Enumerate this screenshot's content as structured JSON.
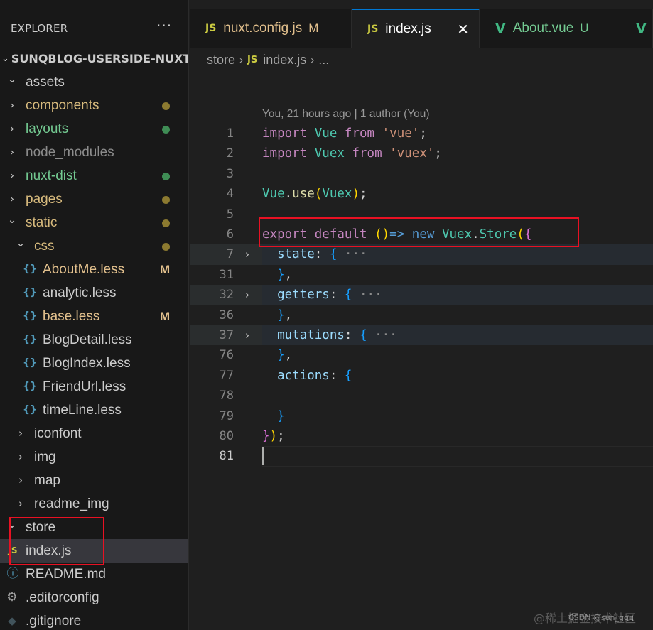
{
  "explorer": {
    "title": "EXPLORER",
    "more_label": "···",
    "root_label": "SUNQBLOG-USERSIDE-NUXT",
    "items": [
      {
        "label": "assets",
        "kind": "folder",
        "open": true,
        "color": "#cccccc"
      },
      {
        "label": "components",
        "kind": "folder",
        "open": false,
        "color": "#d7ba7d",
        "dot": "#8c7a30"
      },
      {
        "label": "layouts",
        "kind": "folder",
        "open": false,
        "color": "#73c991",
        "dot": "#3f8d55"
      },
      {
        "label": "node_modules",
        "kind": "folder",
        "open": false,
        "color": "#8c8c8c"
      },
      {
        "label": "nuxt-dist",
        "kind": "folder",
        "open": false,
        "color": "#73c991",
        "dot": "#3f8d55"
      },
      {
        "label": "pages",
        "kind": "folder",
        "open": false,
        "color": "#d7ba7d",
        "dot": "#8c7a30"
      },
      {
        "label": "static",
        "kind": "folder",
        "open": true,
        "color": "#d7ba7d",
        "dot": "#8c7a30"
      },
      {
        "label": "css",
        "kind": "folder",
        "open": true,
        "color": "#d7ba7d",
        "dot": "#8c7a30"
      },
      {
        "label": "AboutMe.less",
        "kind": "less",
        "color": "#e2c08d",
        "status": "M"
      },
      {
        "label": "analytic.less",
        "kind": "less",
        "color": "#cccccc"
      },
      {
        "label": "base.less",
        "kind": "less",
        "color": "#e2c08d",
        "status": "M"
      },
      {
        "label": "BlogDetail.less",
        "kind": "less",
        "color": "#cccccc"
      },
      {
        "label": "BlogIndex.less",
        "kind": "less",
        "color": "#cccccc"
      },
      {
        "label": "FriendUrl.less",
        "kind": "less",
        "color": "#cccccc"
      },
      {
        "label": "timeLine.less",
        "kind": "less",
        "color": "#cccccc"
      },
      {
        "label": "iconfont",
        "kind": "folder",
        "open": false,
        "color": "#cccccc"
      },
      {
        "label": "img",
        "kind": "folder",
        "open": false,
        "color": "#cccccc"
      },
      {
        "label": "map",
        "kind": "folder",
        "open": false,
        "color": "#cccccc"
      },
      {
        "label": "readme_img",
        "kind": "folder",
        "open": false,
        "color": "#cccccc"
      },
      {
        "label": "store",
        "kind": "folder",
        "open": true,
        "color": "#cccccc"
      },
      {
        "label": "index.js",
        "kind": "js",
        "color": "#cccccc",
        "selected": true
      },
      {
        "label": "README.md",
        "kind": "info",
        "color": "#cccccc"
      },
      {
        "label": ".editorconfig",
        "kind": "gear",
        "color": "#cccccc"
      },
      {
        "label": ".gitignore",
        "kind": "git",
        "color": "#cccccc"
      }
    ]
  },
  "tabs": [
    {
      "icon": "JS",
      "icon_color": "#cbcb41",
      "label": "nuxt.config.js",
      "label_color": "#e2c08d",
      "status": "M",
      "status_color": "#e2c08d",
      "active": false
    },
    {
      "icon": "JS",
      "icon_color": "#cbcb41",
      "label": "index.js",
      "label_color": "#ffffff",
      "status": "",
      "active": true,
      "close": "✕"
    },
    {
      "icon": "V",
      "icon_color": "#41b883",
      "label": "About.vue",
      "label_color": "#73c991",
      "status": "U",
      "status_color": "#73c991",
      "active": false
    },
    {
      "icon": "V",
      "icon_color": "#41b883",
      "label": "",
      "active": false
    }
  ],
  "breadcrumb": {
    "folder": "store",
    "file_icon": "JS",
    "file": "index.js",
    "tail": "..."
  },
  "codelens": "You, 21 hours ago | 1 author (You)",
  "code_lines": [
    {
      "num": "1",
      "fold": "",
      "tokens": [
        [
          "import",
          "kw"
        ],
        [
          " ",
          "pun"
        ],
        [
          "Vue",
          "cls"
        ],
        [
          " ",
          "pun"
        ],
        [
          "from",
          "kw"
        ],
        [
          " ",
          "pun"
        ],
        [
          "'vue'",
          "str"
        ],
        [
          ";",
          "pun"
        ]
      ]
    },
    {
      "num": "2",
      "fold": "",
      "tokens": [
        [
          "import",
          "kw"
        ],
        [
          " ",
          "pun"
        ],
        [
          "Vuex",
          "cls"
        ],
        [
          " ",
          "pun"
        ],
        [
          "from",
          "kw"
        ],
        [
          " ",
          "pun"
        ],
        [
          "'vuex'",
          "str"
        ],
        [
          ";",
          "pun"
        ]
      ]
    },
    {
      "num": "3",
      "fold": "",
      "tokens": []
    },
    {
      "num": "4",
      "fold": "",
      "tokens": [
        [
          "Vue",
          "cls"
        ],
        [
          ".",
          "pun"
        ],
        [
          "use",
          "fn"
        ],
        [
          "(",
          "brk1"
        ],
        [
          "Vuex",
          "cls"
        ],
        [
          ")",
          "brk1"
        ],
        [
          ";",
          "pun"
        ]
      ]
    },
    {
      "num": "5",
      "fold": "",
      "tokens": []
    },
    {
      "num": "6",
      "fold": "",
      "tokens": [
        [
          "export",
          "kw"
        ],
        [
          " ",
          "pun"
        ],
        [
          "default",
          "kw"
        ],
        [
          " ",
          "pun"
        ],
        [
          "()",
          "brk1"
        ],
        [
          "=>",
          "def"
        ],
        [
          " ",
          "pun"
        ],
        [
          "new",
          "def"
        ],
        [
          " ",
          "pun"
        ],
        [
          "Vuex",
          "cls"
        ],
        [
          ".",
          "pun"
        ],
        [
          "Store",
          "cls"
        ],
        [
          "(",
          "brk1"
        ],
        [
          "{",
          "brk2"
        ]
      ]
    },
    {
      "num": "7",
      "fold": "›",
      "folded": true,
      "tokens": [
        [
          "  ",
          "pun"
        ],
        [
          "state",
          "var"
        ],
        [
          ": ",
          "pun"
        ],
        [
          "{",
          "brk3"
        ],
        [
          " ···",
          "ell"
        ]
      ]
    },
    {
      "num": "31",
      "fold": "",
      "tokens": [
        [
          "  ",
          "pun"
        ],
        [
          "}",
          "brk3"
        ],
        [
          ",",
          "pun"
        ]
      ]
    },
    {
      "num": "32",
      "fold": "›",
      "folded": true,
      "tokens": [
        [
          "  ",
          "pun"
        ],
        [
          "getters",
          "var"
        ],
        [
          ": ",
          "pun"
        ],
        [
          "{",
          "brk3"
        ],
        [
          " ···",
          "ell"
        ]
      ]
    },
    {
      "num": "36",
      "fold": "",
      "tokens": [
        [
          "  ",
          "pun"
        ],
        [
          "}",
          "brk3"
        ],
        [
          ",",
          "pun"
        ]
      ]
    },
    {
      "num": "37",
      "fold": "›",
      "folded": true,
      "tokens": [
        [
          "  ",
          "pun"
        ],
        [
          "mutations",
          "var"
        ],
        [
          ": ",
          "pun"
        ],
        [
          "{",
          "brk3"
        ],
        [
          " ···",
          "ell"
        ]
      ]
    },
    {
      "num": "76",
      "fold": "",
      "tokens": [
        [
          "  ",
          "pun"
        ],
        [
          "}",
          "brk3"
        ],
        [
          ",",
          "pun"
        ]
      ]
    },
    {
      "num": "77",
      "fold": "",
      "tokens": [
        [
          "  ",
          "pun"
        ],
        [
          "actions",
          "var"
        ],
        [
          ": ",
          "pun"
        ],
        [
          "{",
          "brk3"
        ]
      ]
    },
    {
      "num": "78",
      "fold": "",
      "tokens": []
    },
    {
      "num": "79",
      "fold": "",
      "tokens": [
        [
          "  ",
          "pun"
        ],
        [
          "}",
          "brk3"
        ]
      ]
    },
    {
      "num": "80",
      "fold": "",
      "tokens": [
        [
          "}",
          "brk2"
        ],
        [
          ")",
          "brk1"
        ],
        [
          ";",
          "pun"
        ]
      ]
    },
    {
      "num": "81",
      "fold": "",
      "current": true,
      "tokens": []
    }
  ],
  "watermark": "@稀土掘金技术社区",
  "watermark2": "CSDN @sun_qqq",
  "colors": {
    "editor_bg": "#1f1f1f",
    "sidebar_bg": "#181818",
    "highlight_box": "#e81123",
    "active_tab_accent": "#0078d4"
  }
}
